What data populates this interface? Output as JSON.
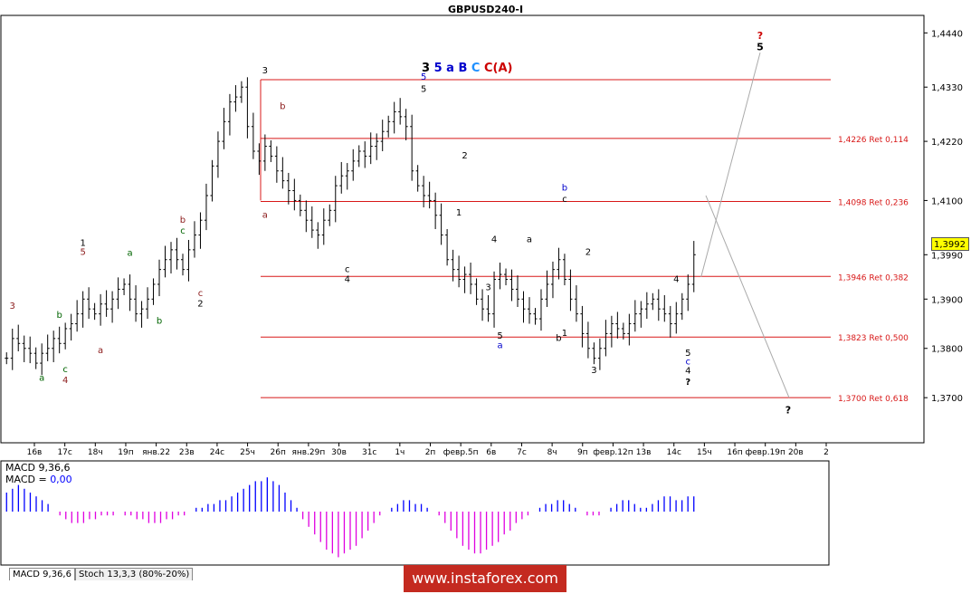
{
  "window_title": "GBPUSD240-I",
  "chart_data": {
    "type": "candlestick",
    "title": "GBPUSD240-I",
    "symbol": "GBPUSD",
    "timeframe": "H4",
    "price_ticks": [
      "1,4440",
      "1,4330",
      "1,4220",
      "1,4100",
      "1,3990",
      "1,3900",
      "1,3800",
      "1,3700"
    ],
    "ylim": [
      1.3614,
      1.447
    ],
    "current_price": "1,3992",
    "time_labels": [
      "16в",
      "17с",
      "18ч",
      "19п",
      "янв.22",
      "23в",
      "24с",
      "25ч",
      "26п",
      "янв.29п",
      "30в",
      "31с",
      "1ч",
      "2п",
      "февр.5п",
      "6в",
      "7с",
      "8ч",
      "9п",
      "февр.12п",
      "13в",
      "14с",
      "15ч",
      "16п",
      "февр.19п",
      "20в",
      "2"
    ],
    "fib_levels": [
      {
        "price": 1.4345,
        "label": ""
      },
      {
        "price": 1.4226,
        "label": "1,4226 Ret 0,114"
      },
      {
        "price": 1.4098,
        "label": "1,4098 Ret 0,236"
      },
      {
        "price": 1.3946,
        "label": "1,3946 Ret 0,382"
      },
      {
        "price": 1.3823,
        "label": "1,3823 Ret 0,500"
      },
      {
        "price": 1.37,
        "label": "1,3700 Ret 0,618"
      }
    ],
    "close_path": [
      1.378,
      1.382,
      1.381,
      1.38,
      1.379,
      1.377,
      1.379,
      1.38,
      1.382,
      1.381,
      1.384,
      1.385,
      1.387,
      1.39,
      1.388,
      1.387,
      1.389,
      1.388,
      1.39,
      1.392,
      1.393,
      1.39,
      1.387,
      1.388,
      1.39,
      1.393,
      1.396,
      1.398,
      1.4,
      1.398,
      1.396,
      1.4,
      1.403,
      1.406,
      1.411,
      1.417,
      1.422,
      1.426,
      1.43,
      1.431,
      1.433,
      1.425,
      1.42,
      1.418,
      1.421,
      1.419,
      1.416,
      1.414,
      1.412,
      1.41,
      1.408,
      1.406,
      1.404,
      1.403,
      1.406,
      1.408,
      1.413,
      1.415,
      1.416,
      1.418,
      1.42,
      1.419,
      1.421,
      1.422,
      1.424,
      1.426,
      1.428,
      1.427,
      1.425,
      1.416,
      1.413,
      1.411,
      1.41,
      1.407,
      1.403,
      1.398,
      1.396,
      1.394,
      1.395,
      1.393,
      1.39,
      1.388,
      1.387,
      1.394,
      1.395,
      1.394,
      1.392,
      1.39,
      1.388,
      1.387,
      1.386,
      1.39,
      1.393,
      1.396,
      1.398,
      1.394,
      1.39,
      1.387,
      1.383,
      1.38,
      1.378,
      1.38,
      1.383,
      1.385,
      1.384,
      1.383,
      1.385,
      1.387,
      1.388,
      1.389,
      1.39,
      1.388,
      1.387,
      1.385,
      1.387,
      1.39,
      1.393,
      1.399
    ],
    "wave_labels": [
      {
        "text": "3",
        "color": "#8b1a1a",
        "i": 1,
        "p": 1.388
      },
      {
        "text": "a",
        "color": "#006400",
        "i": 8,
        "p": 1.3734
      },
      {
        "text": "b",
        "color": "#006400",
        "i": 12,
        "p": 1.3862
      },
      {
        "text": "c",
        "color": "#006400",
        "i": 14,
        "p": 1.3752
      },
      {
        "text": "4",
        "color": "#8b1a1a",
        "i": 14,
        "p": 1.373
      },
      {
        "text": "1",
        "color": "#000000",
        "i": 18,
        "p": 1.4008
      },
      {
        "text": "5",
        "color": "#8b1a1a",
        "i": 18,
        "p": 1.399
      },
      {
        "text": "a",
        "color": "#8b1a1a",
        "i": 22,
        "p": 1.379
      },
      {
        "text": "a",
        "color": "#006400",
        "i": 29,
        "p": 1.3988
      },
      {
        "text": "b",
        "color": "#006400",
        "i": 35,
        "p": 1.385
      },
      {
        "text": "b",
        "color": "#8b1a1a",
        "i": 41,
        "p": 1.4055
      },
      {
        "text": "c",
        "color": "#006400",
        "i": 41,
        "p": 1.4033
      },
      {
        "text": "c",
        "color": "#8b1a1a",
        "i": 45,
        "p": 1.3906
      },
      {
        "text": "2",
        "color": "#000000",
        "i": 45,
        "p": 1.3885
      },
      {
        "text": "3",
        "color": "#000000",
        "i": 59,
        "p": 1.4358
      },
      {
        "text": "a",
        "color": "#8b1a1a",
        "i": 60,
        "p": 1.4065
      },
      {
        "text": "b",
        "color": "#8b1a1a",
        "i": 64,
        "p": 1.4285
      },
      {
        "text": "c",
        "color": "#000000",
        "i": 78,
        "p": 1.3955
      },
      {
        "text": "4",
        "color": "#000000",
        "i": 78,
        "p": 1.3935
      },
      {
        "text": "5",
        "color": "#0000cc",
        "i": 96,
        "p": 1.4345
      },
      {
        "text": "5",
        "color": "#000000",
        "i": 96,
        "p": 1.432
      },
      {
        "text": "1",
        "color": "#000000",
        "i": 104,
        "p": 1.407
      },
      {
        "text": "2",
        "color": "#000000",
        "i": 106,
        "p": 1.4185
      },
      {
        "text": "3",
        "color": "#000000",
        "i": 111,
        "p": 1.3918
      },
      {
        "text": "4",
        "color": "#000000",
        "i": 113,
        "p": 1.4015
      },
      {
        "text": "5",
        "color": "#000000",
        "i": 114,
        "p": 1.382
      },
      {
        "text": "a",
        "color": "#0000cc",
        "i": 114,
        "p": 1.38
      },
      {
        "text": "a",
        "color": "#000000",
        "i": 120,
        "p": 1.4015
      },
      {
        "text": "b",
        "color": "#0000cc",
        "i": 129,
        "p": 1.412
      },
      {
        "text": "c",
        "color": "#000000",
        "i": 129,
        "p": 1.4097
      },
      {
        "text": "1",
        "color": "#000000",
        "i": 129,
        "p": 1.3825
      },
      {
        "text": "b",
        "color": "#000000",
        "i": 127,
        "p": 1.3815
      },
      {
        "text": "2",
        "color": "#000000",
        "i": 134,
        "p": 1.399
      },
      {
        "text": "3",
        "color": "#000000",
        "i": 136,
        "p": 1.375
      },
      {
        "text": "4",
        "color": "#000000",
        "i": 154,
        "p": 1.3935
      },
      {
        "text": "5",
        "color": "#000000",
        "i": 157,
        "p": 1.3785
      },
      {
        "text": "c",
        "color": "#0000cc",
        "i": 157,
        "p": 1.3767
      },
      {
        "text": "4",
        "color": "#000000",
        "i": 157,
        "p": 1.3749
      },
      {
        "text": "?",
        "color": "#000000",
        "i": 157,
        "p": 1.3726
      }
    ],
    "wave_title": [
      {
        "text": "3",
        "color": "#000000"
      },
      {
        "text": "5",
        "color": "#0000cc"
      },
      {
        "text": "a",
        "color": "#0000cc"
      },
      {
        "text": "B",
        "color": "#0000cc"
      },
      {
        "text": "C",
        "color": "#1e90ff"
      },
      {
        "text": "C",
        "color": "#cc0000"
      },
      {
        "text": "(A)",
        "color": "#cc0000"
      }
    ],
    "projection_labels": [
      {
        "text": "?",
        "color": "#cc0000"
      },
      {
        "text": "5",
        "color": "#000000"
      },
      {
        "text": "?",
        "color": "#000000"
      }
    ]
  },
  "macd": {
    "label_name": "MACD 9,36,6",
    "label_value_prefix": "MACD = ",
    "label_value": "0,00",
    "histogram": [
      5,
      6,
      7,
      6,
      5,
      4,
      3,
      2,
      0,
      -1,
      -2,
      -3,
      -3,
      -3,
      -2,
      -2,
      -1,
      -1,
      -1,
      0,
      -1,
      -1,
      -2,
      -2,
      -3,
      -3,
      -3,
      -2,
      -2,
      -1,
      -1,
      0,
      1,
      1,
      2,
      2,
      3,
      3,
      4,
      5,
      6,
      7,
      8,
      8,
      9,
      8,
      7,
      5,
      3,
      1,
      -2,
      -4,
      -6,
      -8,
      -10,
      -11,
      -12,
      -11,
      -10,
      -9,
      -7,
      -5,
      -3,
      -1,
      0,
      1,
      2,
      3,
      3,
      2,
      2,
      1,
      0,
      -1,
      -3,
      -5,
      -7,
      -9,
      -10,
      -11,
      -11,
      -10,
      -9,
      -8,
      -6,
      -5,
      -3,
      -2,
      -1,
      0,
      1,
      2,
      2,
      3,
      3,
      2,
      1,
      0,
      -1,
      -1,
      -1,
      0,
      1,
      2,
      3,
      3,
      2,
      1,
      1,
      2,
      3,
      4,
      4,
      3,
      3,
      4,
      4
    ]
  },
  "tabs": [
    "MACD 9,36,6",
    "Stoch 13,3,3 (80%-20%)"
  ],
  "watermark": "www.instaforex.com"
}
